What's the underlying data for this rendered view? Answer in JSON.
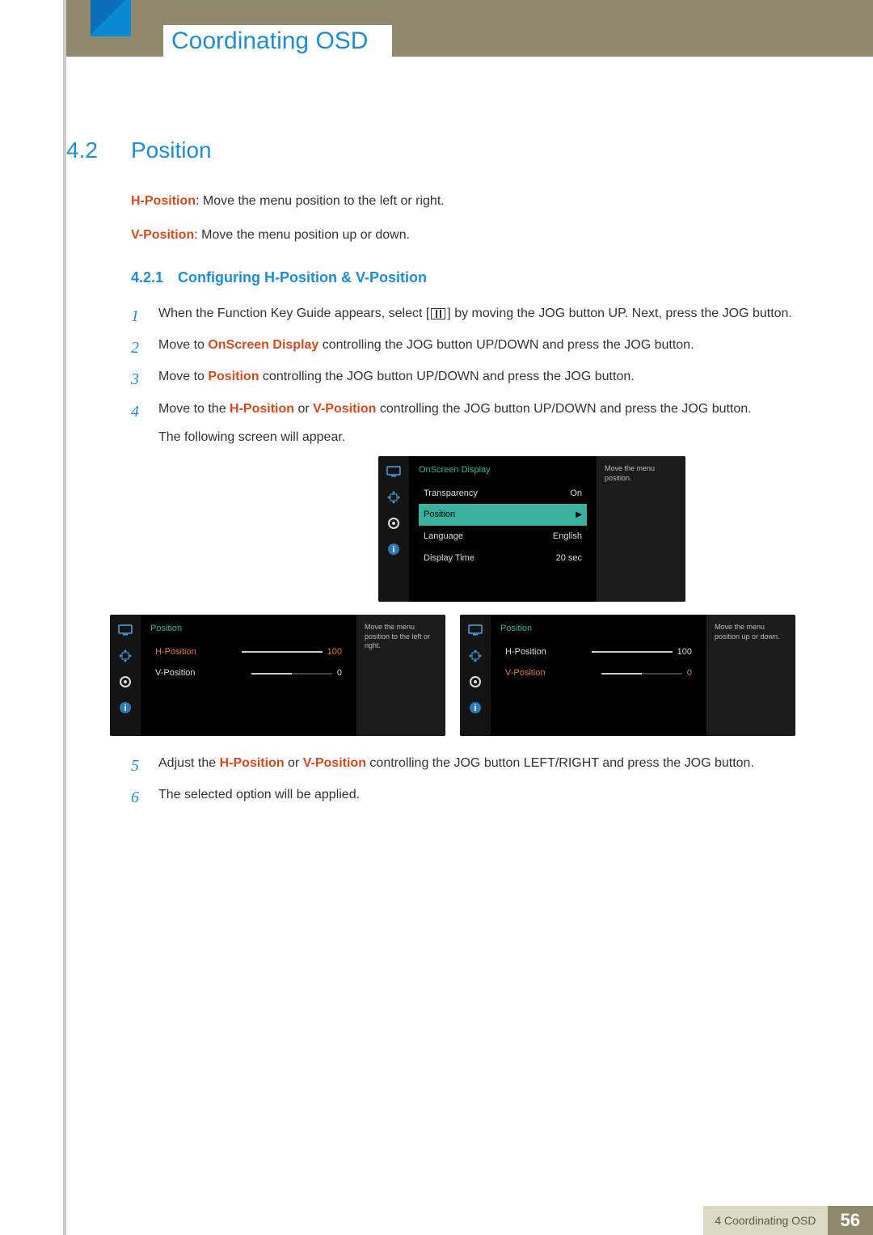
{
  "header": {
    "chapter_title": "Coordinating OSD"
  },
  "section": {
    "number": "4.2",
    "title": "Position"
  },
  "intro": {
    "h_label": "H-Position",
    "h_text": ": Move the menu position to the left or right.",
    "v_label": "V-Position",
    "v_text": ": Move the menu position up or down."
  },
  "subsection": {
    "number": "4.2.1",
    "title": "Configuring H-Position &  V-Position"
  },
  "steps": {
    "s1a": "When the Function Key Guide appears, select [",
    "s1b": "] by moving the JOG button UP. Next, press the JOG button.",
    "s2a": "Move to ",
    "s2_hl": "OnScreen Display",
    "s2b": " controlling the JOG button UP/DOWN and press the JOG button.",
    "s3a": "Move to ",
    "s3_hl": "Position",
    "s3b": " controlling the JOG button UP/DOWN and press the JOG button.",
    "s4a": "Move to the ",
    "s4_hl1": "H-Position",
    "s4_mid": " or ",
    "s4_hl2": "V-Position",
    "s4b": " controlling the JOG button UP/DOWN and press the JOG button.",
    "s4c": "The following screen will appear.",
    "s5a": "Adjust the ",
    "s5_hl1": "H-Position",
    "s5_mid": " or ",
    "s5_hl2": "V-Position",
    "s5b": " controlling the JOG button LEFT/RIGHT and press the JOG button.",
    "s6": "The selected option will be applied."
  },
  "osd1": {
    "title": "OnScreen Display",
    "r1_label": "Transparency",
    "r1_val": "On",
    "r2_label": "Position",
    "r3_label": "Language",
    "r3_val": "English",
    "r4_label": "Display Time",
    "r4_val": "20 sec",
    "help": "Move the menu position."
  },
  "osd2": {
    "title": "Position",
    "r1_label": "H-Position",
    "r1_val": "100",
    "r2_label": "V-Position",
    "r2_val": "0",
    "help": "Move the menu position to the left or right."
  },
  "osd3": {
    "title": "Position",
    "r1_label": "H-Position",
    "r1_val": "100",
    "r2_label": "V-Position",
    "r2_val": "0",
    "help": "Move the menu position up or down."
  },
  "footer": {
    "label": "4 Coordinating OSD",
    "page": "56"
  }
}
